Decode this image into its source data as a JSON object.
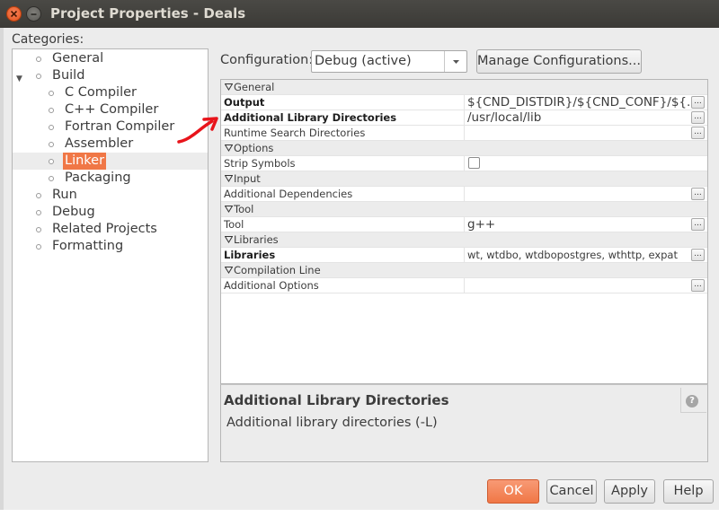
{
  "window": {
    "title": "Project Properties - Deals"
  },
  "categories": {
    "label": "Categories:",
    "items": [
      {
        "label": "General",
        "level": 1
      },
      {
        "label": "Build",
        "level": 1
      },
      {
        "label": "C Compiler",
        "level": 2
      },
      {
        "label": "C++ Compiler",
        "level": 2
      },
      {
        "label": "Fortran Compiler",
        "level": 2
      },
      {
        "label": "Assembler",
        "level": 2
      },
      {
        "label": "Linker",
        "level": 2
      },
      {
        "label": "Packaging",
        "level": 2
      },
      {
        "label": "Run",
        "level": 1
      },
      {
        "label": "Debug",
        "level": 1
      },
      {
        "label": "Related Projects",
        "level": 1
      },
      {
        "label": "Formatting",
        "level": 1
      }
    ],
    "selected": "Linker"
  },
  "configuration": {
    "label": "Configuration:",
    "selected": "Debug (active)",
    "manage_label": "Manage Configurations..."
  },
  "properties": {
    "groups": [
      {
        "name": "General",
        "rows": [
          {
            "name": "Output",
            "bold": true,
            "value": "${CND_DISTDIR}/${CND_CONF}/${...",
            "button": true
          },
          {
            "name": "Additional Library Directories",
            "bold": true,
            "value": "/usr/local/lib",
            "button": true
          },
          {
            "name": "Runtime Search Directories",
            "bold": false,
            "value": "",
            "button": true
          }
        ]
      },
      {
        "name": "Options",
        "rows": [
          {
            "name": "Strip Symbols",
            "bold": false,
            "checkbox": true,
            "checked": false
          }
        ]
      },
      {
        "name": "Input",
        "rows": [
          {
            "name": "Additional Dependencies",
            "bold": false,
            "value": "",
            "button": true
          }
        ]
      },
      {
        "name": "Tool",
        "rows": [
          {
            "name": "Tool",
            "bold": false,
            "value": "g++",
            "button": true
          }
        ]
      },
      {
        "name": "Libraries",
        "rows": [
          {
            "name": "Libraries",
            "bold": true,
            "value": "wt, wtdbo, wtdbopostgres, wthttp, expat",
            "button": true
          }
        ]
      },
      {
        "name": "Compilation Line",
        "rows": [
          {
            "name": "Additional Options",
            "bold": false,
            "value": "",
            "button": true
          }
        ]
      }
    ],
    "ellipsis": "..."
  },
  "description": {
    "title": "Additional Library Directories",
    "text": "Additional library directories (-L)",
    "help": "?"
  },
  "buttons": {
    "ok": "OK",
    "cancel": "Cancel",
    "apply": "Apply",
    "help": "Help"
  },
  "colors": {
    "accent": "#f07746",
    "annotation_arrow": "#e8141b"
  }
}
